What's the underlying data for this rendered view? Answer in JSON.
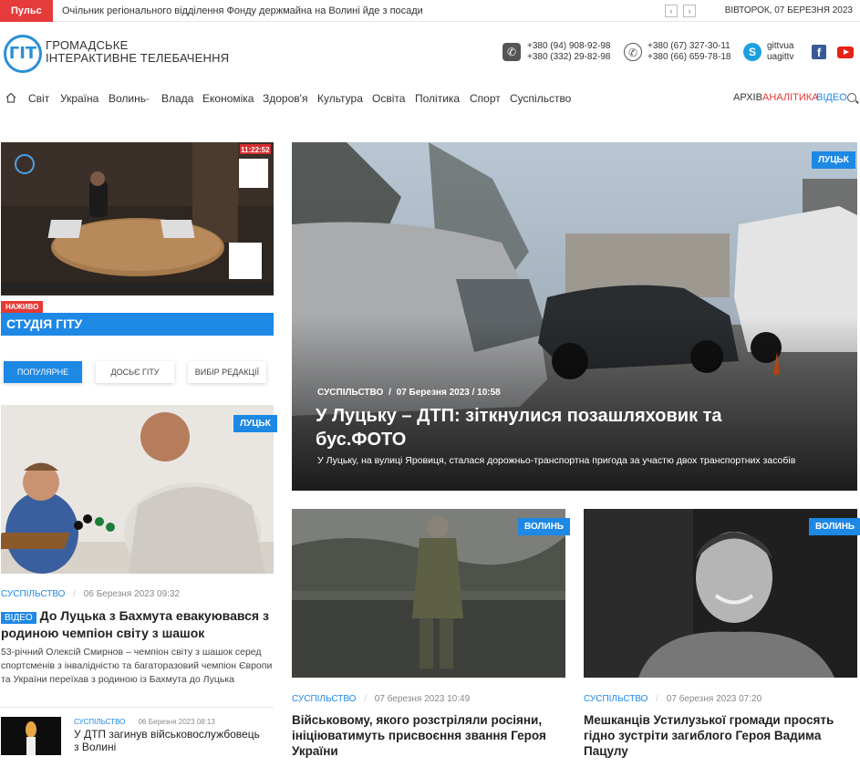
{
  "topbar": {
    "pulse_label": "Пульс",
    "ticker_text": "Очільник регіонального відділення Фонду держмайна на Волині йде з посади",
    "prev_label": "‹",
    "next_label": "›",
    "date": "ВІВТОРОК, 07 БЕРЕЗНЯ 2023"
  },
  "header": {
    "logo_mark": "ГІТ",
    "logo_line1": "ГРОМАДСЬКЕ",
    "logo_line2": "ІНТЕРАКТИВНЕ ТЕЛЕБАЧЕННЯ",
    "phones_1": [
      "+380 (94) 908-92-98",
      "+380 (332) 29-82-98"
    ],
    "phones_2": [
      "+380 (67) 327-30-11",
      "+380 (66) 659-78-18"
    ],
    "skype": [
      "gittvua",
      "uagittv"
    ]
  },
  "nav": {
    "items": [
      "Світ",
      "Україна",
      "Волинь",
      "Влада",
      "Економіка",
      "Здоров'я",
      "Культура",
      "Освіта",
      "Політика",
      "Спорт",
      "Суспільство"
    ],
    "archive": "АРХІВ",
    "analytics": "АНАЛІТИКА",
    "video": "ВІДЕО"
  },
  "live": {
    "time": "11:22:52",
    "badge": "НАЖИВО",
    "title": "СТУДІЯ ГІТУ"
  },
  "tabs": [
    "ПОПУЛЯРНЕ",
    "ДОСЬЄ ГІТУ",
    "ВИБІР РЕДАКЦІЇ"
  ],
  "hero": {
    "tag": "ЛУЦЬК",
    "category": "СУСПІЛЬСТВО",
    "date": "07 Березня 2023 / 10:58",
    "title": "У Луцьку – ДТП: зіткнулися позашляховик та бус.ФОТО",
    "excerpt": "У Луцьку, на вулиці Яровиця, сталася дорожньо-транспортна пригода за участю двох транспортних засобів"
  },
  "left_card": {
    "tag": "ЛУЦЬК",
    "category": "СУСПІЛЬСТВО",
    "date": "06 Березня 2023 09:32",
    "video_badge": "ВІДЕО",
    "title": "До Луцька з Бахмута евакуювався з родиною чемпіон світу з шашок",
    "excerpt": "53-річний Олексій Смирнов – чемпіон світу з шашок серед спортсменів з інвалідністю та багаторазовий чемпіон Європи та України переїхав з родиною із Бахмута до Луцька"
  },
  "small_item": {
    "category": "СУСПІЛЬСТВО",
    "date": "06 Березня 2023 08:13",
    "title": "У ДТП загинув військовослужбовець з Волині"
  },
  "mid_card": {
    "tag": "ВОЛИНЬ",
    "category": "СУСПІЛЬСТВО",
    "date": "07 березня 2023 10:49",
    "title": "Військовому, якого розстріляли росіяни, ініціюватимуть присвоєння звання Героя України"
  },
  "right_card": {
    "tag": "ВОЛИНЬ",
    "category": "СУСПІЛЬСТВО",
    "date": "07 березня 2023 07:20",
    "title": "Мешканців Устилузької громади просять гідно зустріти загиблого Героя Вадима Пацулу"
  },
  "colors": {
    "accent": "#1e88e5",
    "pulse": "#e63b3b",
    "analytics": "#e53935"
  }
}
